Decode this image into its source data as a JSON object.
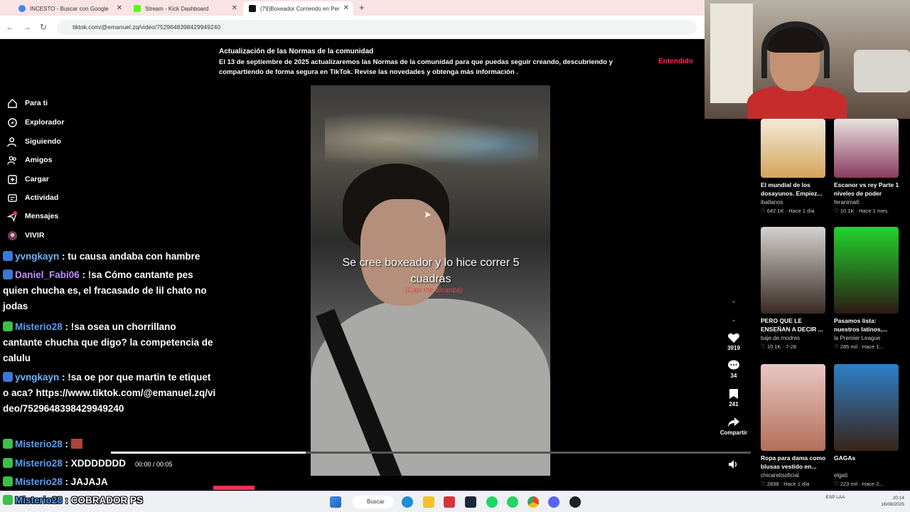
{
  "browser": {
    "tabs": [
      {
        "label": "INCESTO - Buscar con Google",
        "favicon_color": "#4285f4"
      },
      {
        "label": "Stream - Kick Dashboard",
        "favicon_color": "#53fc18"
      },
      {
        "label": "(79)Boxeador Corriendo en Per",
        "favicon_color": "#111111"
      }
    ],
    "url": "tiktok.com/@emanuel.zq/video/7529648398429949240"
  },
  "banner": {
    "title": "Actualización de las Normas de la comunidad",
    "text": "El 13 de septiembre de 2025 actualizaremos las Normas de la comunidad para que puedas seguir creando, descubriendo y compartiendo de forma segura en TikTok. Revise las novedades y obtenga más información .",
    "button": "Entendido"
  },
  "sidebar": {
    "items": [
      {
        "label": "Para ti",
        "icon": "home-icon"
      },
      {
        "label": "Explorador",
        "icon": "compass-icon"
      },
      {
        "label": "Siguiendo",
        "icon": "following-icon"
      },
      {
        "label": "Amigos",
        "icon": "friends-icon"
      },
      {
        "label": "Cargar",
        "icon": "upload-icon"
      },
      {
        "label": "Actividad",
        "icon": "activity-icon"
      },
      {
        "label": "Mensajes",
        "icon": "messages-icon",
        "badge": "79"
      },
      {
        "label": "VIVIR",
        "icon": "live-icon"
      }
    ]
  },
  "video": {
    "caption": "Se cree boxeador y lo hice correr 5 cuadras",
    "sub_caption": "(Casi me alcanza)",
    "time": "00:00 / 00:05",
    "progress": 0.304
  },
  "actions": {
    "likes": "3919",
    "comments": "34",
    "saves": "241",
    "share": "Compartir"
  },
  "recommendations": [
    {
      "title": "El mundial de los dosayunos. Empiez...",
      "author": "iballanos",
      "likes": "642.1K",
      "time": "Hace 1 día",
      "colors": [
        "#f2ead9",
        "#d5a45a"
      ]
    },
    {
      "title": "Escanor vs rey Parte 1 niveles de poder",
      "author": "feranima6",
      "likes": "10.1K",
      "time": "Hace 1 mes.",
      "colors": [
        "#e7e2df",
        "#8a3b5f"
      ]
    },
    {
      "title": "PERO QUE LE ENSEÑAN A DECIR ...",
      "author": "baje.de.modres",
      "likes": "10.1K",
      "time": "7-28",
      "colors": [
        "#d4d2cf",
        "#3a2a24"
      ]
    },
    {
      "title": "Pasamos lista: nuestros latinos,...",
      "author": "la Premier League",
      "likes": "285 mil",
      "time": "Hace 1...",
      "colors": [
        "#22d42b",
        "#2c1a14"
      ]
    },
    {
      "title": "Ropa para dama como blusas vestido en...",
      "author": "chicarelisoficial",
      "likes": "2838",
      "time": "Hace 1 día",
      "colors": [
        "#e8c7c2",
        "#b36f5a"
      ]
    },
    {
      "title": "GAGAs",
      "author": "elgati",
      "likes": "223 mil",
      "time": "Hace 2...",
      "colors": [
        "#2d7fc7",
        "#3a2418"
      ]
    }
  ],
  "chat": [
    {
      "user": "yvngkayn",
      "text": ": tu causa andaba con hambre",
      "color": "#6ab7ff"
    },
    {
      "user": "Daniel_Fabi06",
      "text": ": !sa Cómo cantante pes quien chucha es, el fracasado de lil chato no jodas",
      "color": "#c58cff"
    },
    {
      "user": "Misterio28",
      "text": ": !sa osea un chorrillano cantante chucha que digo? la competencia de calulu",
      "color": "#5a9ff2"
    },
    {
      "user": "yvngkayn",
      "text": ": !sa oe por que martin te etiqueto aca? https://www.tiktok.com/@emanuel.zq/video/7529648398429949240",
      "color": "#6ab7ff"
    },
    {
      "user": "Misterio28",
      "text": ":",
      "color": "#5a9ff2"
    },
    {
      "user": "Misterio28",
      "text": ": XDDDDDDD",
      "color": "#5a9ff2"
    },
    {
      "user": "Misterio28",
      "text": ": JAJAJA",
      "color": "#5a9ff2"
    }
  ],
  "last_chat": {
    "user": "Misterio28",
    "text": ": COBRADOR PS"
  },
  "taskbar": {
    "search": "Buscar",
    "lang": "ESP LAA",
    "time": "20:14",
    "date": "16/08/2025"
  }
}
